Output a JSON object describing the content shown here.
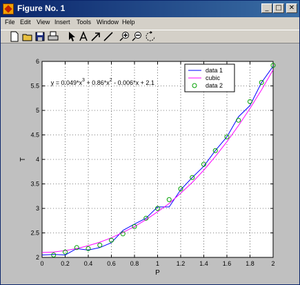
{
  "window": {
    "title": "Figure No. 1",
    "minimize": "_",
    "maximize": "□",
    "close": "✕"
  },
  "menu": [
    "File",
    "Edit",
    "View",
    "Insert",
    "Tools",
    "Window",
    "Help"
  ],
  "toolbar": [
    "new-icon",
    "open-icon",
    "save-icon",
    "print-icon",
    "select-arrow-icon",
    "text-icon",
    "arrow-icon",
    "line-icon",
    "zoom-in-icon",
    "zoom-out-icon",
    "rotate-icon"
  ],
  "chart_data": {
    "type": "line",
    "title": "",
    "xlabel": "P",
    "ylabel": "T",
    "xlim": [
      0,
      2
    ],
    "ylim": [
      2,
      6
    ],
    "xticks": [
      0,
      0.2,
      0.4,
      0.6,
      0.8,
      1,
      1.2,
      1.4,
      1.6,
      1.8,
      2
    ],
    "xtick_labels": [
      "0",
      "0.2",
      "0.4",
      "0.6",
      "0.8",
      "1",
      "1.2",
      "1.4",
      "1.6",
      "1.8",
      "2"
    ],
    "yticks": [
      2,
      2.5,
      3,
      3.5,
      4,
      4.5,
      5,
      5.5,
      6
    ],
    "ytick_labels": [
      "2",
      "2.5",
      "3",
      "3.5",
      "4",
      "4.5",
      "5",
      "5.5",
      "6"
    ],
    "grid": true,
    "annotation": {
      "parts": [
        "y = 0.049*x",
        "3",
        " + 0.86*x",
        "2",
        " - 0.006*x + 2.1"
      ],
      "x": 0.1,
      "y": 5.52
    },
    "legend": {
      "position": "top-right",
      "entries": [
        "data 1",
        "cubic",
        "data 2"
      ]
    },
    "series": [
      {
        "name": "data 1",
        "kind": "line",
        "color": "#0000ff",
        "x": [
          0,
          0.1,
          0.2,
          0.3,
          0.4,
          0.5,
          0.6,
          0.7,
          0.8,
          0.9,
          1.0,
          1.1,
          1.2,
          1.3,
          1.4,
          1.5,
          1.6,
          1.7,
          1.8,
          1.9,
          2.0
        ],
        "y": [
          2.05,
          2.06,
          2.05,
          2.18,
          2.15,
          2.2,
          2.3,
          2.55,
          2.68,
          2.8,
          3.03,
          3.03,
          3.38,
          3.63,
          3.86,
          4.18,
          4.46,
          4.87,
          5.1,
          5.57,
          5.9
        ]
      },
      {
        "name": "cubic",
        "kind": "line",
        "color": "#ff00ff",
        "x": [
          0,
          0.1,
          0.2,
          0.3,
          0.4,
          0.5,
          0.6,
          0.7,
          0.8,
          0.9,
          1.0,
          1.1,
          1.2,
          1.3,
          1.4,
          1.5,
          1.6,
          1.7,
          1.8,
          1.9,
          2.0
        ],
        "y": [
          2.1,
          2.11,
          2.14,
          2.18,
          2.24,
          2.31,
          2.4,
          2.51,
          2.63,
          2.77,
          2.93,
          3.1,
          3.31,
          3.53,
          3.78,
          4.06,
          4.36,
          4.69,
          5.04,
          5.42,
          5.83
        ]
      },
      {
        "name": "data 2",
        "kind": "scatter",
        "color": "#00a000",
        "x": [
          0.1,
          0.2,
          0.3,
          0.4,
          0.5,
          0.6,
          0.7,
          0.8,
          0.9,
          1.0,
          1.1,
          1.2,
          1.3,
          1.4,
          1.5,
          1.6,
          1.7,
          1.8,
          1.9,
          2.0
        ],
        "y": [
          2.05,
          2.11,
          2.2,
          2.18,
          2.25,
          2.35,
          2.48,
          2.63,
          2.8,
          3.0,
          3.18,
          3.4,
          3.63,
          3.9,
          4.18,
          4.46,
          4.8,
          5.18,
          5.57,
          5.92
        ]
      }
    ]
  }
}
